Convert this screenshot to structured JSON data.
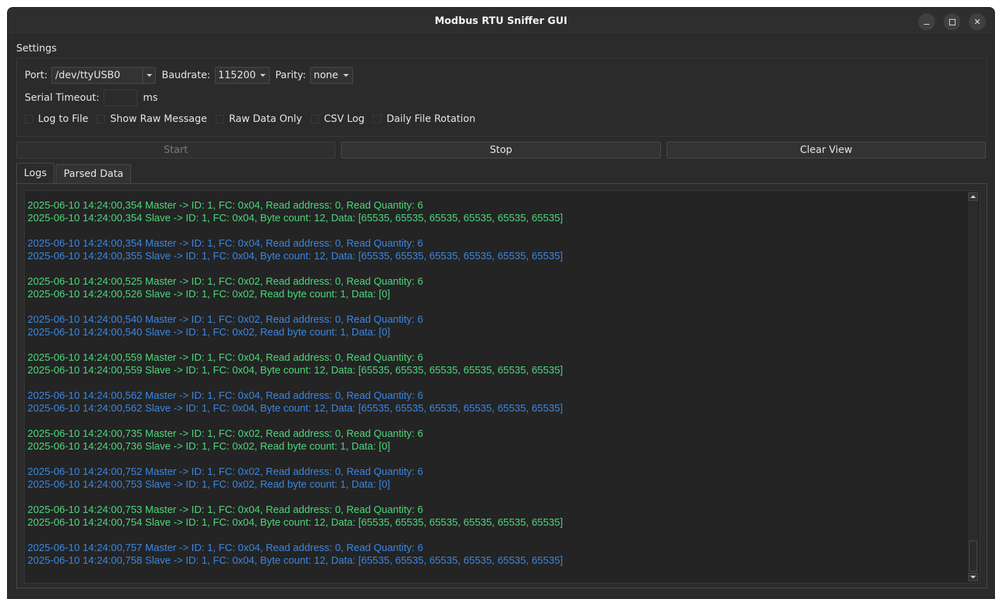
{
  "window": {
    "title": "Modbus RTU Sniffer GUI"
  },
  "settings": {
    "group_label": "Settings",
    "port_label": "Port:",
    "port_value": "/dev/ttyUSB0",
    "baudrate_label": "Baudrate:",
    "baudrate_value": "115200",
    "parity_label": "Parity:",
    "parity_value": "none",
    "timeout_label": "Serial Timeout:",
    "timeout_value": "",
    "timeout_unit": "ms",
    "checkboxes": [
      {
        "label": "Log to File",
        "checked": false
      },
      {
        "label": "Show Raw Message",
        "checked": false
      },
      {
        "label": "Raw Data Only",
        "checked": false
      },
      {
        "label": "CSV Log",
        "checked": false
      },
      {
        "label": "Daily File Rotation",
        "checked": false
      }
    ]
  },
  "buttons": {
    "start": "Start",
    "stop": "Stop",
    "clear": "Clear View"
  },
  "tabs": [
    {
      "label": "Logs",
      "active": true
    },
    {
      "label": "Parsed Data",
      "active": false
    }
  ],
  "colors": {
    "green": "#4cd67a",
    "blue": "#3a86e0"
  },
  "log_entries": [
    {
      "color": "green",
      "master": "2025-06-10 14:24:00,354 Master -> ID: 1, FC: 0x04, Read address: 0, Read Quantity: 6",
      "slave": "2025-06-10 14:24:00,354 Slave -> ID: 1, FC: 0x04, Byte count: 12, Data: [65535, 65535, 65535, 65535, 65535, 65535]"
    },
    {
      "color": "blue",
      "master": "2025-06-10 14:24:00,354 Master -> ID: 1, FC: 0x04, Read address: 0, Read Quantity: 6",
      "slave": "2025-06-10 14:24:00,355 Slave -> ID: 1, FC: 0x04, Byte count: 12, Data: [65535, 65535, 65535, 65535, 65535, 65535]"
    },
    {
      "color": "green",
      "master": "2025-06-10 14:24:00,525 Master -> ID: 1, FC: 0x02, Read address: 0, Read Quantity: 6",
      "slave": "2025-06-10 14:24:00,526 Slave -> ID: 1, FC: 0x02, Read byte count: 1, Data: [0]"
    },
    {
      "color": "blue",
      "master": "2025-06-10 14:24:00,540 Master -> ID: 1, FC: 0x02, Read address: 0, Read Quantity: 6",
      "slave": "2025-06-10 14:24:00,540 Slave -> ID: 1, FC: 0x02, Read byte count: 1, Data: [0]"
    },
    {
      "color": "green",
      "master": "2025-06-10 14:24:00,559 Master -> ID: 1, FC: 0x04, Read address: 0, Read Quantity: 6",
      "slave": "2025-06-10 14:24:00,559 Slave -> ID: 1, FC: 0x04, Byte count: 12, Data: [65535, 65535, 65535, 65535, 65535, 65535]"
    },
    {
      "color": "blue",
      "master": "2025-06-10 14:24:00,562 Master -> ID: 1, FC: 0x04, Read address: 0, Read Quantity: 6",
      "slave": "2025-06-10 14:24:00,562 Slave -> ID: 1, FC: 0x04, Byte count: 12, Data: [65535, 65535, 65535, 65535, 65535, 65535]"
    },
    {
      "color": "green",
      "master": "2025-06-10 14:24:00,735 Master -> ID: 1, FC: 0x02, Read address: 0, Read Quantity: 6",
      "slave": "2025-06-10 14:24:00,736 Slave -> ID: 1, FC: 0x02, Read byte count: 1, Data: [0]"
    },
    {
      "color": "blue",
      "master": "2025-06-10 14:24:00,752 Master -> ID: 1, FC: 0x02, Read address: 0, Read Quantity: 6",
      "slave": "2025-06-10 14:24:00,753 Slave -> ID: 1, FC: 0x02, Read byte count: 1, Data: [0]"
    },
    {
      "color": "green",
      "master": "2025-06-10 14:24:00,753 Master -> ID: 1, FC: 0x04, Read address: 0, Read Quantity: 6",
      "slave": "2025-06-10 14:24:00,754 Slave -> ID: 1, FC: 0x04, Byte count: 12, Data: [65535, 65535, 65535, 65535, 65535, 65535]"
    },
    {
      "color": "blue",
      "master": "2025-06-10 14:24:00,757 Master -> ID: 1, FC: 0x04, Read address: 0, Read Quantity: 6",
      "slave": "2025-06-10 14:24:00,758 Slave -> ID: 1, FC: 0x04, Byte count: 12, Data: [65535, 65535, 65535, 65535, 65535, 65535]"
    }
  ]
}
